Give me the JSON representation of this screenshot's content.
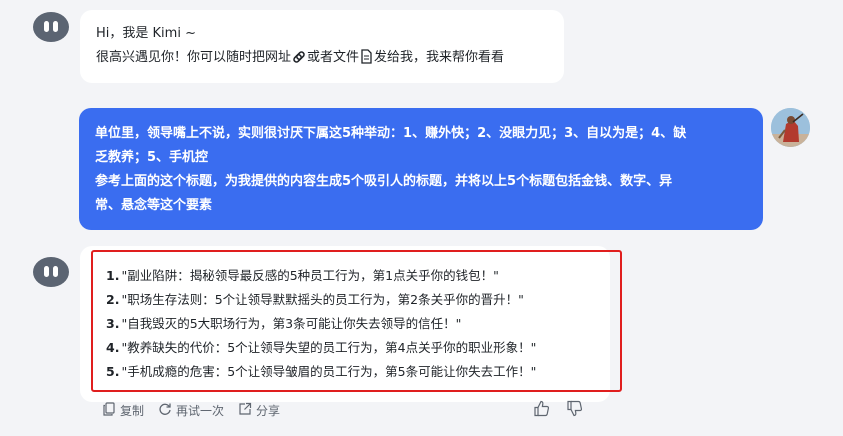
{
  "greeting": {
    "line1": "Hi，我是 Kimi ~",
    "line2_part1": "很高兴遇见你！你可以随时把网址",
    "line2_part2": "或者文件",
    "line2_part3": "发给我，我来帮你看看"
  },
  "user_message": {
    "line1": "单位里，领导嘴上不说，实则很讨厌下属这5种举动：1、赚外快；2、没眼力见；3、自以为是；4、缺",
    "line2": "乏教养；5、手机控",
    "line3": "参考上面的这个标题，为我提供的内容生成5个吸引人的标题，并将以上5个标题包括金钱、数字、异",
    "line4": "常、悬念等这个要素"
  },
  "answer": {
    "items": [
      {
        "num": "1.",
        "text": "\"副业陷阱：揭秘领导最反感的5种员工行为，第1点关乎你的钱包！\""
      },
      {
        "num": "2.",
        "text": "\"职场生存法则：5个让领导默默摇头的员工行为，第2条关乎你的晋升！\""
      },
      {
        "num": "3.",
        "text": "\"自我毁灭的5大职场行为，第3条可能让你失去领导的信任！\""
      },
      {
        "num": "4.",
        "text": "\"教养缺失的代价：5个让领导失望的员工行为，第4点关乎你的职业形象！\""
      },
      {
        "num": "5.",
        "text": "\"手机成瘾的危害：5个让领导皱眉的员工行为，第5条可能让你失去工作！\""
      }
    ]
  },
  "actions": {
    "copy": "复制",
    "retry": "再试一次",
    "share": "分享"
  },
  "icons": {
    "link": "link-icon",
    "file": "file-icon",
    "copy": "copy-icon",
    "retry": "refresh-icon",
    "share": "share-icon",
    "like": "thumbs-up-icon",
    "dislike": "thumbs-down-icon"
  },
  "colors": {
    "user_bubble": "#3a6df0",
    "highlight_border": "#e01e1e",
    "bot_avatar": "#5b6472"
  }
}
